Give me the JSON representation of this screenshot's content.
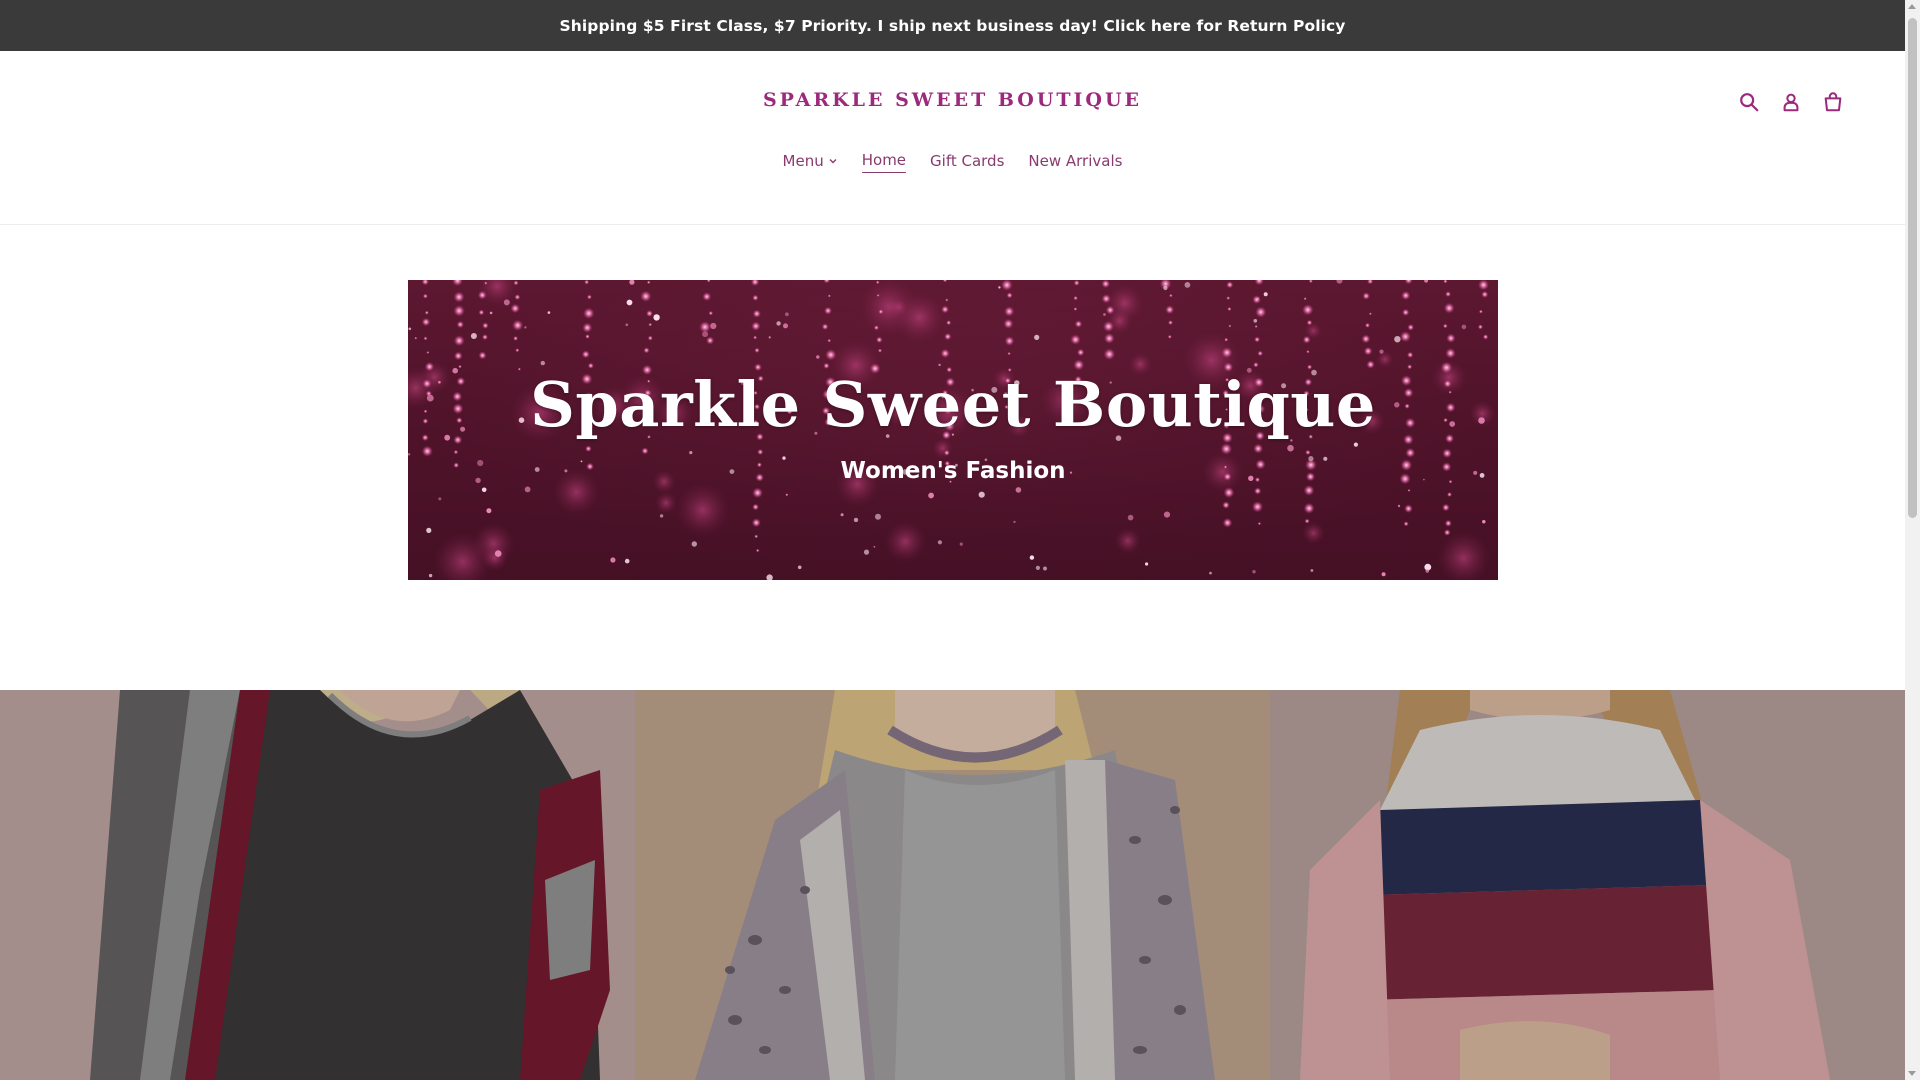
{
  "announcement": {
    "text": "Shipping $5 First Class, $7 Priority. I ship next business day! Click here for Return Policy"
  },
  "header": {
    "logo": "SPARKLE SWEET BOUTIQUE",
    "icons": [
      "search-icon",
      "account-icon",
      "cart-icon"
    ],
    "nav": [
      {
        "label": "Menu",
        "has_dropdown": true,
        "active": false
      },
      {
        "label": "Home",
        "has_dropdown": false,
        "active": true
      },
      {
        "label": "Gift Cards",
        "has_dropdown": false,
        "active": false
      },
      {
        "label": "New Arrivals",
        "has_dropdown": false,
        "active": false
      }
    ]
  },
  "hero": {
    "title": "Sparkle Sweet Boutique",
    "subtitle": "Women's Fashion"
  },
  "collage": {
    "tiles": [
      {
        "kind": "product-photo",
        "description_icon": "charcoal-colorblock-top-image"
      },
      {
        "kind": "product-photo",
        "description_icon": "leopard-sleeve-top-image"
      },
      {
        "kind": "product-photo",
        "description_icon": "striped-colorblock-top-image"
      }
    ]
  },
  "colors": {
    "accent": "#9b2a7c",
    "nav_text": "#8a3a6e",
    "announcement_bg": "#3a3a3a",
    "hero_bg": "#5a1730"
  }
}
